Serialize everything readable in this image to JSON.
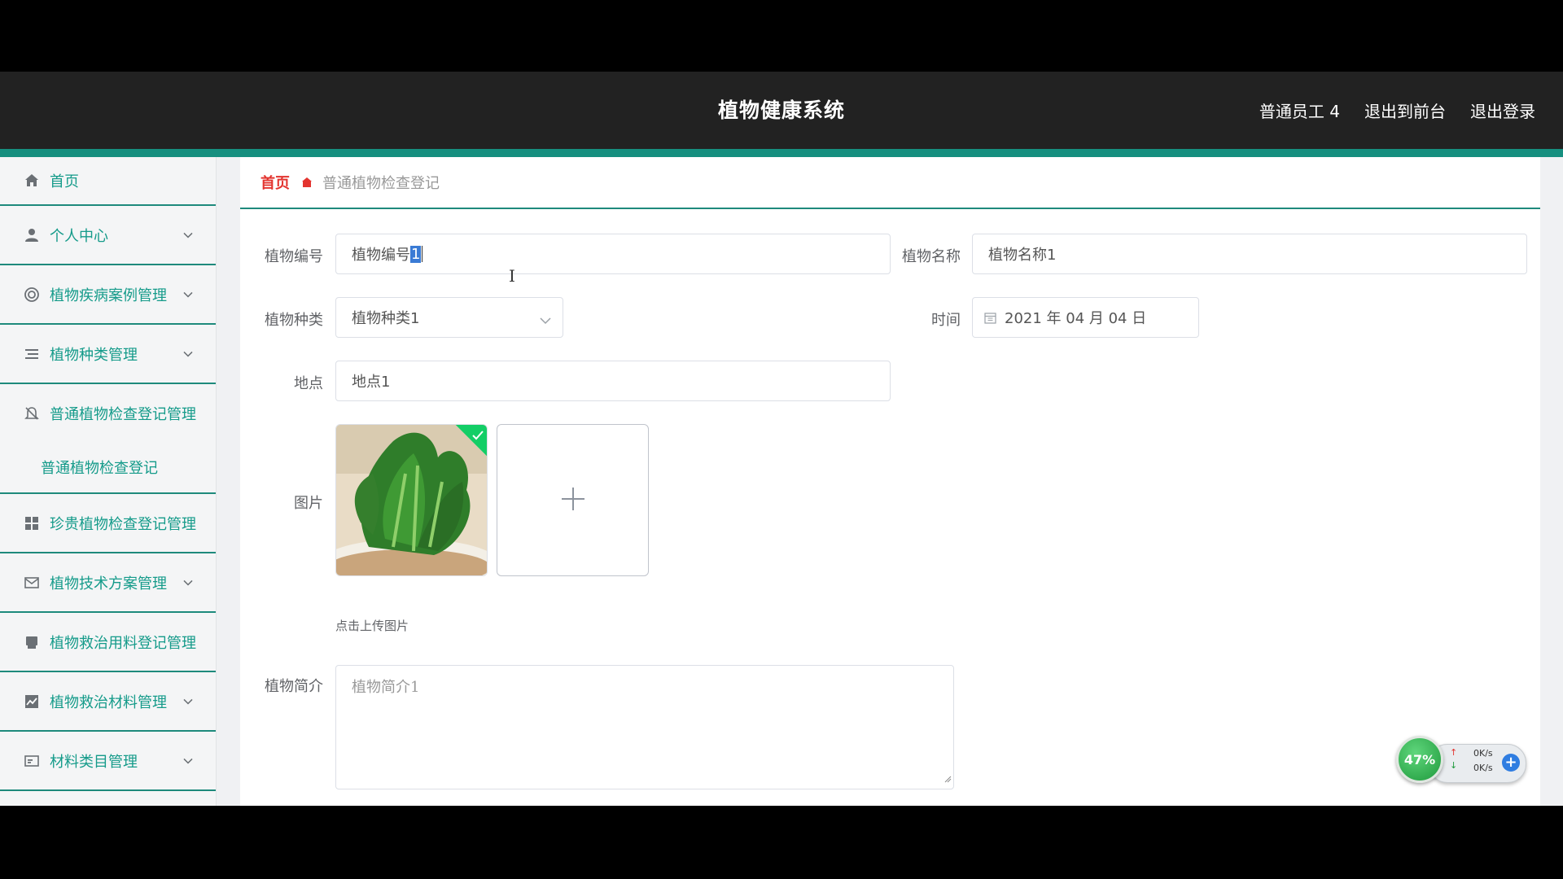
{
  "header": {
    "title": "植物健康系统",
    "user": "普通员工 4",
    "to_front": "退出到前台",
    "logout": "退出登录"
  },
  "sidebar": {
    "items": [
      {
        "label": "首页",
        "icon": "home-icon"
      },
      {
        "label": "个人中心",
        "icon": "user-icon"
      },
      {
        "label": "植物疾病案例管理",
        "icon": "target-icon"
      },
      {
        "label": "植物种类管理",
        "icon": "list-icon"
      },
      {
        "label": "普通植物检查登记管理",
        "icon": "bell-off-icon"
      },
      {
        "label": "普通植物检查登记",
        "icon": ""
      },
      {
        "label": "珍贵植物检查登记管理",
        "icon": "grid-icon"
      },
      {
        "label": "植物技术方案管理",
        "icon": "mail-icon"
      },
      {
        "label": "植物救治用料登记管理",
        "icon": "printer-icon"
      },
      {
        "label": "植物救治材料管理",
        "icon": "chart-icon"
      },
      {
        "label": "材料类目管理",
        "icon": "card-icon"
      }
    ]
  },
  "breadcrumb": {
    "home": "首页",
    "current": "普通植物检查登记"
  },
  "form": {
    "plant_no_label": "植物编号",
    "plant_no_value_prefix": "植物编号",
    "plant_no_value_selected": "1",
    "plant_name_label": "植物名称",
    "plant_name_value": "植物名称1",
    "plant_type_label": "植物种类",
    "plant_type_value": "植物种类1",
    "time_label": "时间",
    "time_value": "2021 年 04 月 04 日",
    "location_label": "地点",
    "location_value": "地点1",
    "image_label": "图片",
    "upload_tip": "点击上传图片",
    "intro_label": "植物简介",
    "intro_value": "植物简介1"
  },
  "net_widget": {
    "percent": "47%",
    "up_rate": "0K/s",
    "down_rate": "0K/s"
  },
  "colors": {
    "accent": "#168f7f",
    "menu_text": "#159b8a",
    "header_bg": "#222222",
    "breadcrumb_home": "#e3342f"
  }
}
